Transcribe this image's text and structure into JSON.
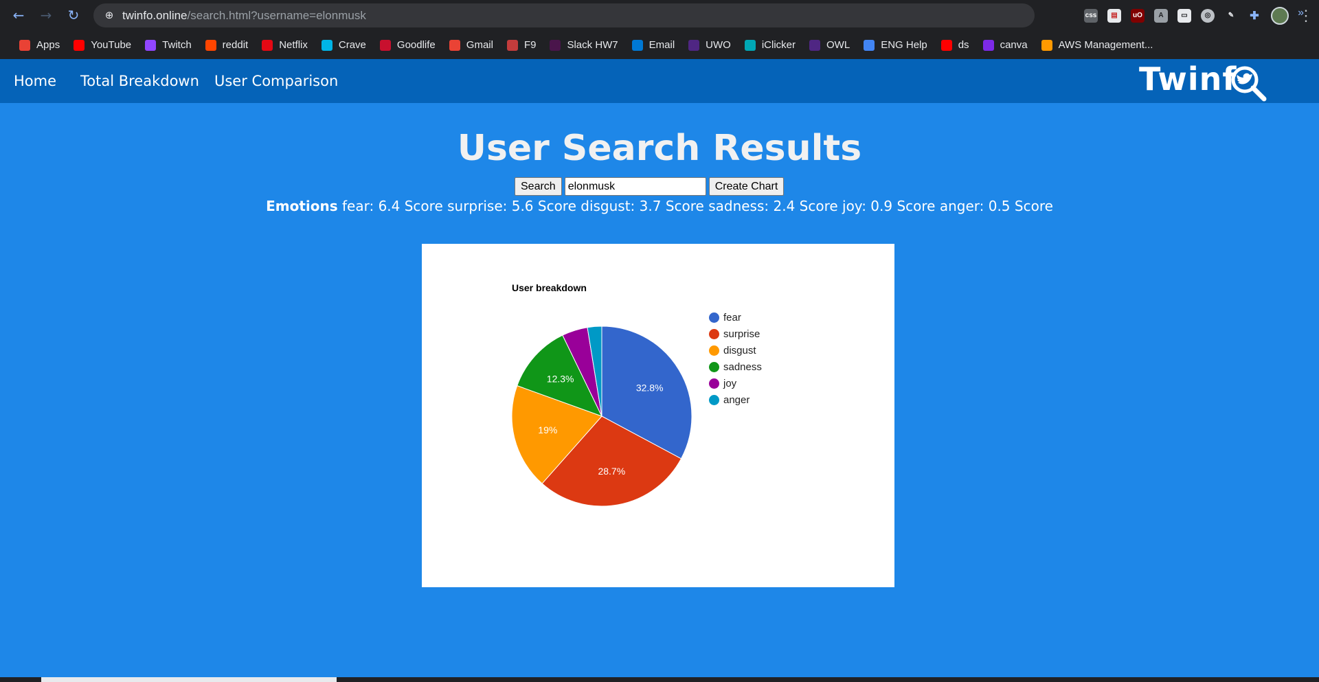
{
  "browser": {
    "url_host": "twinfo.online",
    "url_path": "/search.html?username=elonmusk",
    "bookmarks": [
      {
        "label": "Apps",
        "color": "#e94235"
      },
      {
        "label": "YouTube",
        "color": "#ff0000"
      },
      {
        "label": "Twitch",
        "color": "#9146ff"
      },
      {
        "label": "reddit",
        "color": "#ff4500"
      },
      {
        "label": "Netflix",
        "color": "#e50914"
      },
      {
        "label": "Crave",
        "color": "#00b4e6"
      },
      {
        "label": "Goodlife",
        "color": "#c8102e"
      },
      {
        "label": "Gmail",
        "color": "#ea4335"
      },
      {
        "label": "F9",
        "color": "#c43c3c"
      },
      {
        "label": "Slack HW7",
        "color": "#4a154b"
      },
      {
        "label": "Email",
        "color": "#0078d4"
      },
      {
        "label": "UWO",
        "color": "#4f2683"
      },
      {
        "label": "iClicker",
        "color": "#00a7b5"
      },
      {
        "label": "OWL",
        "color": "#4f2683"
      },
      {
        "label": "ENG Help",
        "color": "#4285f4"
      },
      {
        "label": "ds",
        "color": "#ff0000"
      },
      {
        "label": "canva",
        "color": "#7d2ae8"
      },
      {
        "label": "AWS Management...",
        "color": "#ff9900"
      }
    ],
    "more": "»"
  },
  "nav": {
    "home": "Home",
    "total_breakdown": "Total Breakdown",
    "user_comparison": "User Comparison",
    "logo": "Twinf"
  },
  "page": {
    "title": "User Search Results",
    "search_button": "Search",
    "search_value": "elonmusk",
    "create_chart_button": "Create Chart",
    "emotions_label": "Emotions",
    "emotions_text": "fear: 6.4 Score surprise: 5.6 Score disgust: 3.7 Score sadness: 2.4 Score joy: 0.9 Score anger: 0.5 Score"
  },
  "chart_data": {
    "type": "pie",
    "title": "User breakdown",
    "categories": [
      "fear",
      "surprise",
      "disgust",
      "sadness",
      "joy",
      "anger"
    ],
    "values": [
      6.4,
      5.6,
      3.7,
      2.4,
      0.9,
      0.5
    ],
    "slice_labels": [
      "32.8%",
      "28.7%",
      "19%",
      "12.3%",
      "",
      ""
    ],
    "colors": [
      "#3366cc",
      "#dc3912",
      "#ff9900",
      "#109618",
      "#990099",
      "#0099c6"
    ],
    "legend_position": "right"
  }
}
